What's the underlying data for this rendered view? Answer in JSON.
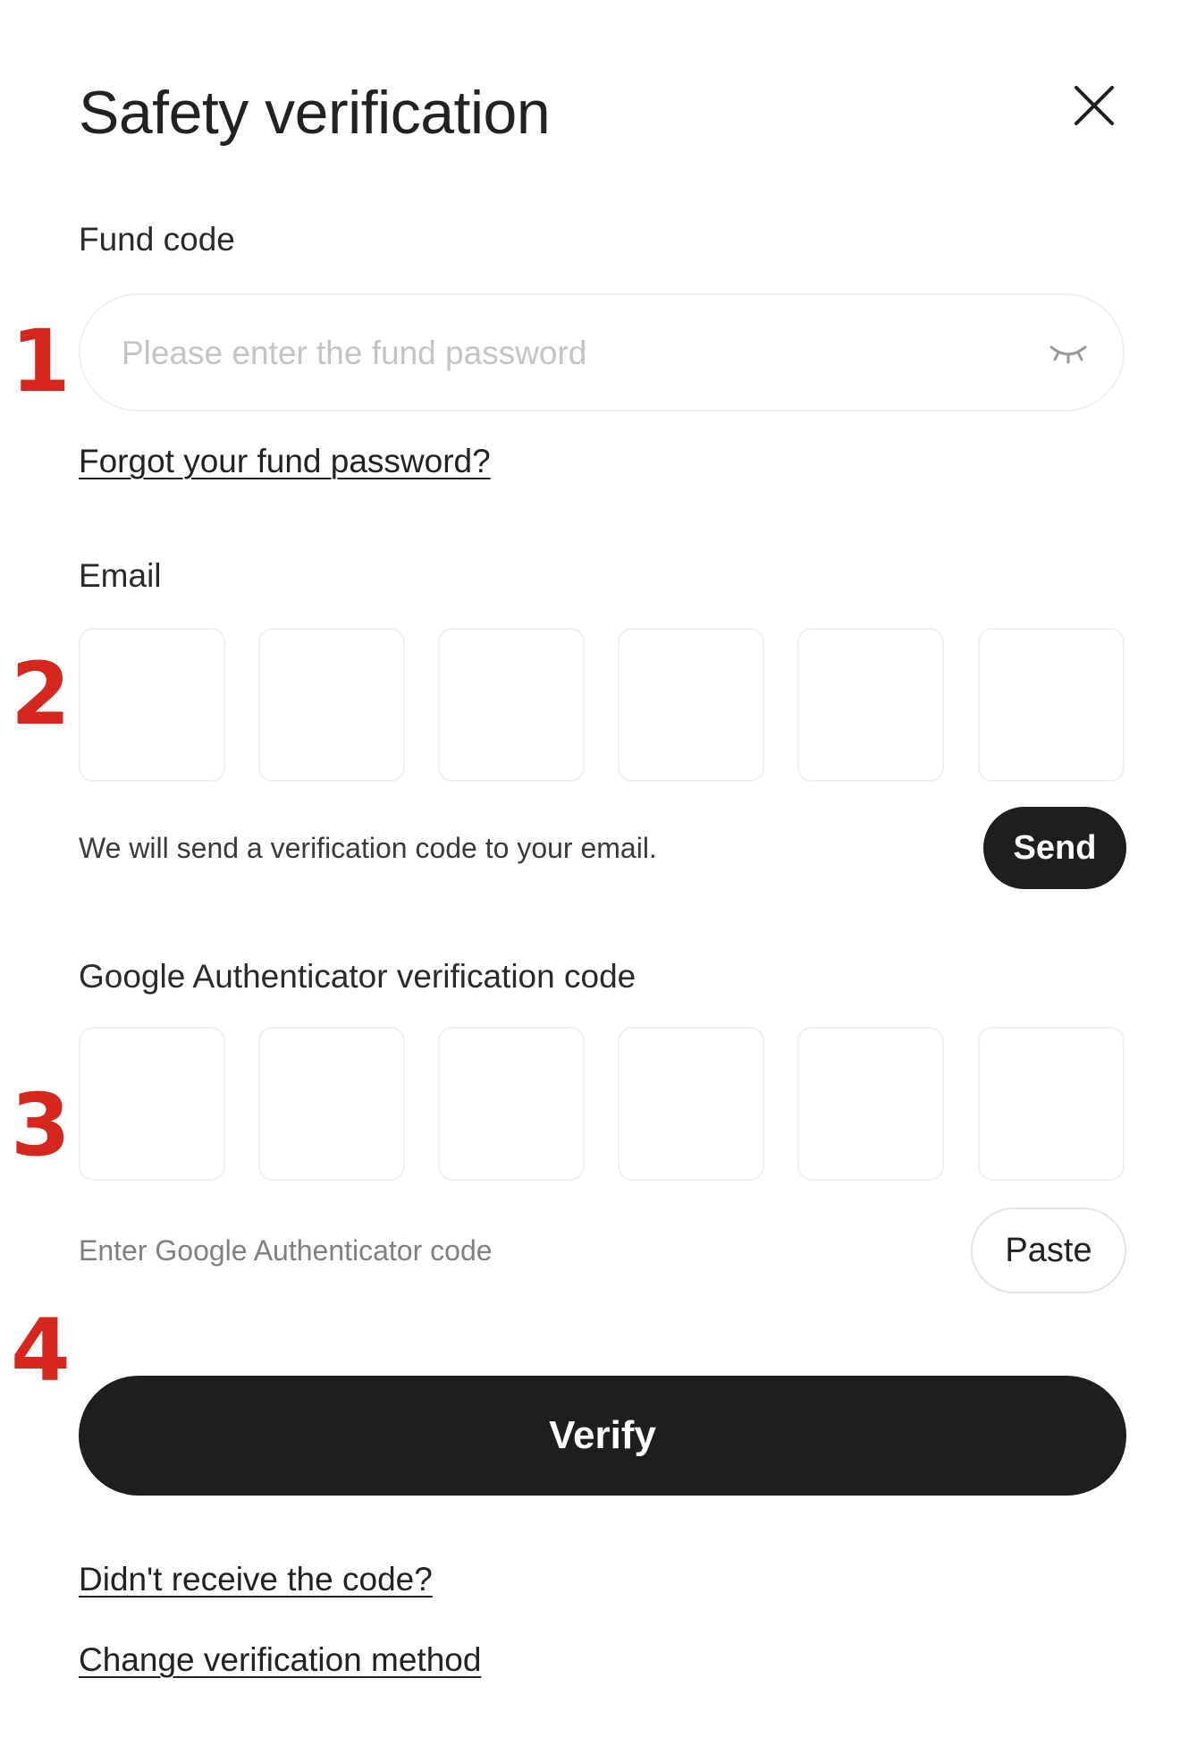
{
  "dialog": {
    "title": "Safety verification",
    "close_icon": "close-icon"
  },
  "steps": [
    "1",
    "2",
    "3",
    "4"
  ],
  "fund_code": {
    "label": "Fund code",
    "placeholder": "Please enter the fund password",
    "value": "",
    "toggle_icon": "eye-closed-icon",
    "forgot_link": "Forgot your fund password?"
  },
  "email": {
    "label": "Email",
    "digits": [
      "",
      "",
      "",
      "",
      "",
      ""
    ],
    "hint": "We will send a verification code to your email.",
    "send_label": "Send"
  },
  "google_auth": {
    "label": "Google Authenticator verification code",
    "digits": [
      "",
      "",
      "",
      "",
      "",
      ""
    ],
    "hint": "Enter Google Authenticator code",
    "paste_label": "Paste"
  },
  "actions": {
    "verify_label": "Verify",
    "didnt_receive_link": "Didn't receive the code?",
    "change_method_link": "Change verification method"
  },
  "colors": {
    "primary_button": "#1e1e1e",
    "step_number": "#d6271f",
    "border": "#efefef"
  }
}
